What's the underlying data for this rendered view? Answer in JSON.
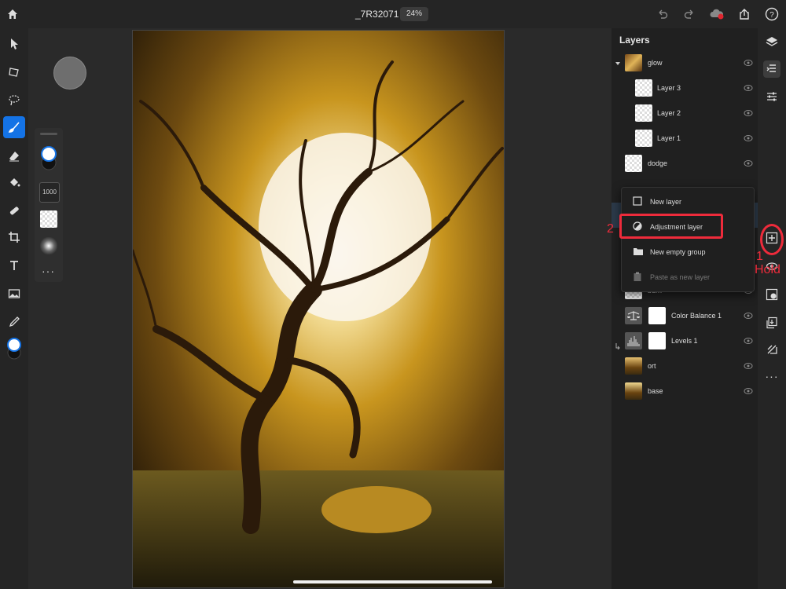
{
  "header": {
    "doc_title": "_7R32071",
    "zoom": "24%",
    "icons": [
      "home-icon",
      "undo-icon",
      "redo-icon",
      "cloud-sync-icon",
      "share-icon",
      "help-icon"
    ]
  },
  "brush_options": {
    "size": "1000"
  },
  "layers_panel": {
    "title": "Layers",
    "layers": [
      {
        "name": "glow"
      },
      {
        "name": "Layer 3"
      },
      {
        "name": "Layer 2"
      },
      {
        "name": "Layer 1"
      },
      {
        "name": "dodge"
      },
      {
        "name": "burn"
      },
      {
        "name": "Color Balance 1"
      },
      {
        "name": "Levels 1"
      },
      {
        "name": "ort"
      },
      {
        "name": "base"
      }
    ]
  },
  "context_menu": {
    "items": [
      {
        "label": "New layer",
        "icon": "square-icon"
      },
      {
        "label": "Adjustment layer",
        "icon": "half-circle-icon"
      },
      {
        "label": "New empty group",
        "icon": "folder-icon"
      },
      {
        "label": "Paste as new layer",
        "icon": "clipboard-icon"
      }
    ]
  },
  "annotations": {
    "step1": "1",
    "hold": "Hold",
    "step2": "2"
  },
  "colors": {
    "accent": "#1473e6",
    "annotation": "#ee2b3b"
  }
}
